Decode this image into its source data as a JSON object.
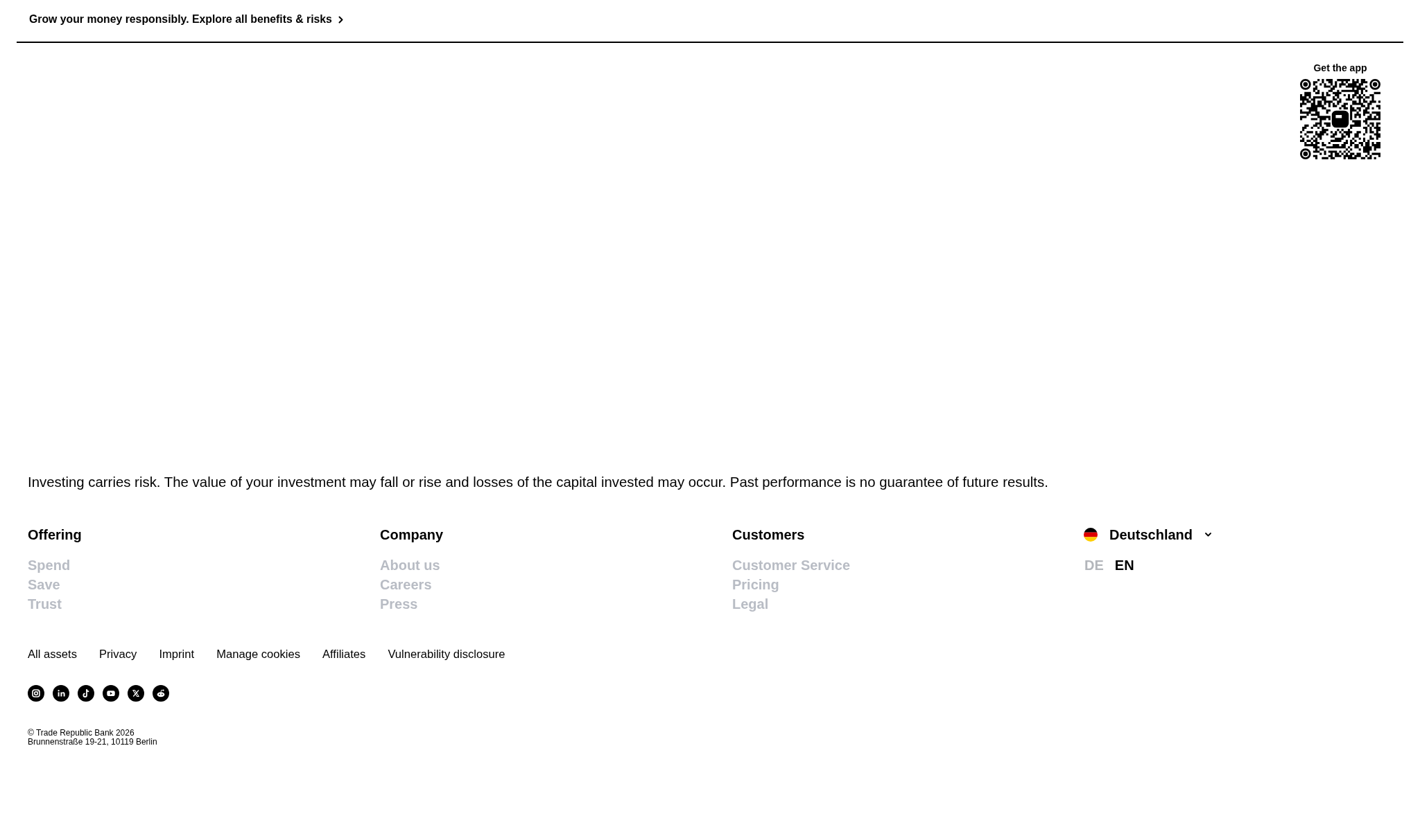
{
  "banner": {
    "text": "Grow your money responsibly. Explore all benefits & risks"
  },
  "app_promo": {
    "title": "Get the app"
  },
  "disclaimer": "Investing carries risk. The value of your investment may fall or rise and losses of the capital invested may occur. Past performance is no guarantee of future results.",
  "footer_columns": [
    {
      "heading": "Offering",
      "links": [
        "Spend",
        "Save",
        "Trust"
      ]
    },
    {
      "heading": "Company",
      "links": [
        "About us",
        "Careers",
        "Press"
      ]
    },
    {
      "heading": "Customers",
      "links": [
        "Customer Service",
        "Pricing",
        "Legal"
      ]
    }
  ],
  "region": {
    "country": "Deutschland",
    "languages": [
      {
        "label": "DE",
        "selected": false
      },
      {
        "label": "EN",
        "selected": true
      }
    ]
  },
  "legal_links": [
    "All assets",
    "Privacy",
    "Imprint",
    "Manage cookies",
    "Affiliates",
    "Vulnerability disclosure"
  ],
  "copyright": [
    "© Trade Republic Bank 2026",
    "Brunnenstraße 19-21, 10119 Berlin"
  ]
}
